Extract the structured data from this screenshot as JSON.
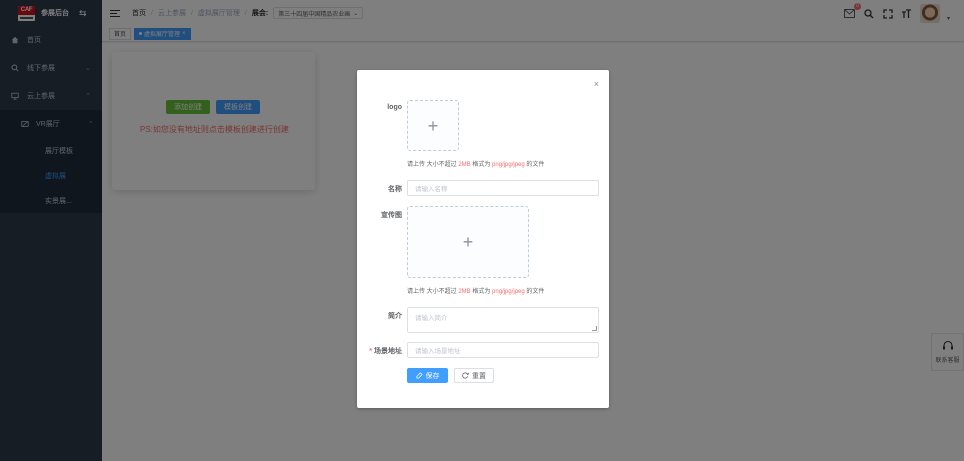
{
  "sidebar": {
    "logo_text": "CAF",
    "title": "参展后台",
    "toggle_icon": "switch-icon",
    "items": [
      {
        "label": "首页",
        "icon": "home-icon"
      },
      {
        "label": "线下参展",
        "icon": "search-icon"
      },
      {
        "label": "云上参展",
        "icon": "monitor-icon"
      }
    ],
    "submenu_title": "VR展厅",
    "submenu_icon": "vr-icon",
    "sub_items": [
      {
        "label": "展厅模板"
      },
      {
        "label": "虚拟展"
      },
      {
        "label": "实景展..."
      }
    ]
  },
  "header": {
    "breadcrumb": [
      "首页",
      "云上参展",
      "虚拟展厅管理"
    ],
    "fair_label": "展会:",
    "fair_select": "第三十四届中国精品农业画",
    "message_badge": "0"
  },
  "tags": {
    "home": "首页",
    "active": "虚拟展厅管理"
  },
  "content": {
    "add_button": "添加创建",
    "template_button": "模板创建",
    "ps_text": "PS:如您没有地址则点击模板创建进行创建",
    "contact_label": "联系客服"
  },
  "dialog": {
    "close": "×",
    "logo_label": "logo",
    "logo_tip": {
      "pre": "请上传 大小不超过 ",
      "size": "2MB",
      "mid": " 格式为 ",
      "formats": "png/jpg/jpeg",
      "post": " 的文件"
    },
    "name_label": "名称",
    "name_placeholder": "请输入名称",
    "banner_label": "宣传图",
    "banner_tip": {
      "pre": "请上传 大小不超过 ",
      "size": "2MB",
      "mid": " 格式为 ",
      "formats": "png/jpg/jpeg",
      "post": " 的文件"
    },
    "intro_label": "简介",
    "intro_placeholder": "请输入简介",
    "scene_label": "场景地址",
    "scene_placeholder": "请输入场景地址",
    "save_label": "保存",
    "reset_label": "重置"
  },
  "colors": {
    "primary": "#409eff",
    "success": "#67c23a",
    "danger": "#f56c6c",
    "sidebar": "#2d3a4b"
  }
}
